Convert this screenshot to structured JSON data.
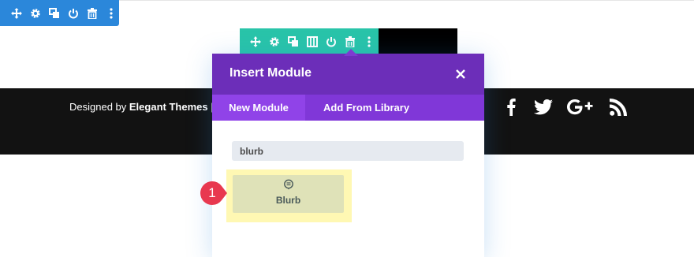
{
  "section_toolbar": {
    "icons": [
      "move-icon",
      "gear-icon",
      "duplicate-icon",
      "power-icon",
      "trash-icon",
      "more-icon"
    ],
    "color": "#2b87da"
  },
  "row_toolbar": {
    "icons": [
      "move-icon",
      "gear-icon",
      "duplicate-icon",
      "columns-icon",
      "power-icon",
      "trash-icon",
      "more-icon"
    ],
    "color": "#29c4a9"
  },
  "footer": {
    "credit_prefix": "Designed by ",
    "credit_brand": "Elegant Themes",
    "credit_separator": " |",
    "social_icons": [
      "facebook-icon",
      "twitter-icon",
      "google-plus-icon",
      "rss-icon"
    ]
  },
  "modal": {
    "title": "Insert Module",
    "tabs": [
      {
        "label": "New Module",
        "active": true
      },
      {
        "label": "Add From Library",
        "active": false
      }
    ],
    "search_value": "blurb",
    "modules": [
      {
        "label": "Blurb",
        "icon": "blurb-icon"
      }
    ],
    "header_color": "#6c2eb9",
    "tab_bar_color": "#8037d8"
  },
  "step_marker": {
    "number": "1",
    "color": "#e8384f"
  }
}
